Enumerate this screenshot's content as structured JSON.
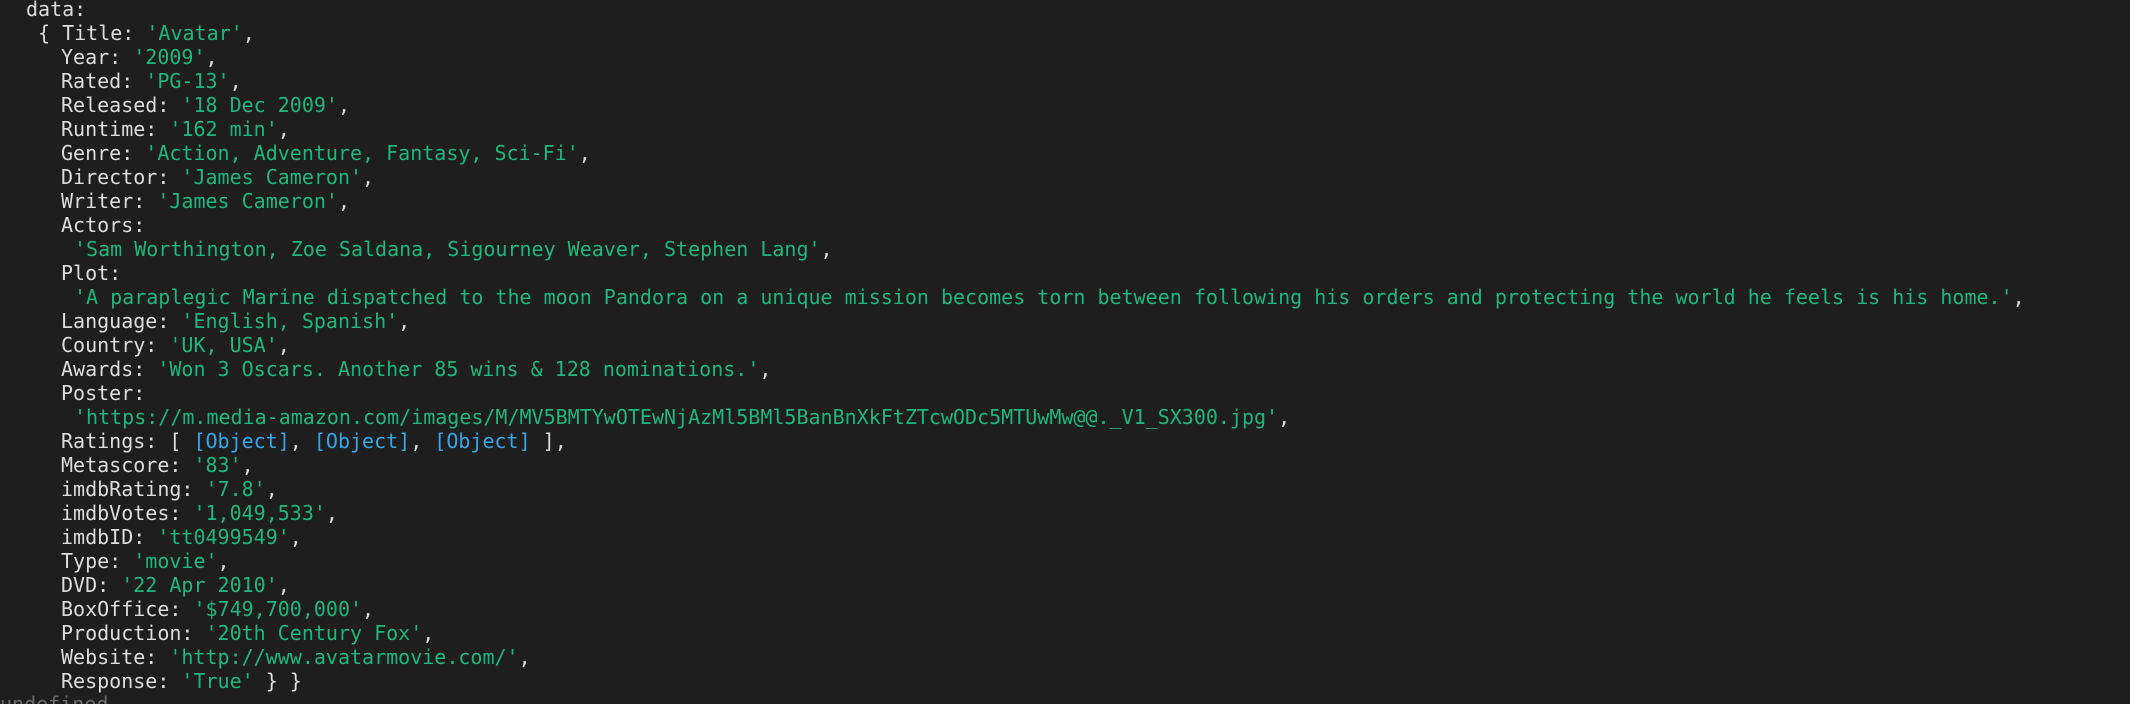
{
  "colors": {
    "background": "#1e1e1e",
    "text": "#dcdcdc",
    "string": "#1bb67f",
    "object": "#35a7e6",
    "dim": "#6b6b6b"
  },
  "header": "data:",
  "fields": {
    "Title": "'Avatar'",
    "Year": "'2009'",
    "Rated": "'PG-13'",
    "Released": "'18 Dec 2009'",
    "Runtime": "'162 min'",
    "Genre": "'Action, Adventure, Fantasy, Sci-Fi'",
    "Director": "'James Cameron'",
    "Writer": "'James Cameron'",
    "Actors": "'Sam Worthington, Zoe Saldana, Sigourney Weaver, Stephen Lang'",
    "Plot": "'A paraplegic Marine dispatched to the moon Pandora on a unique mission becomes torn between following his orders and protecting the world he feels is his home.'",
    "Language": "'English, Spanish'",
    "Country": "'UK, USA'",
    "Awards": "'Won 3 Oscars. Another 85 wins & 128 nominations.'",
    "Poster": "'https://m.media-amazon.com/images/M/MV5BMTYwOTEwNjAzMl5BMl5BanBnXkFtZTcwODc5MTUwMw@@._V1_SX300.jpg'",
    "Ratings": "[Object]",
    "Metascore": "'83'",
    "imdbRating": "'7.8'",
    "imdbVotes": "'1,049,533'",
    "imdbID": "'tt0499549'",
    "Type": "'movie'",
    "DVD": "'22 Apr 2010'",
    "BoxOffice": "'$749,700,000'",
    "Production": "'20th Century Fox'",
    "Website": "'http://www.avatarmovie.com/'",
    "Response": "'True'"
  },
  "footer": "undefined"
}
